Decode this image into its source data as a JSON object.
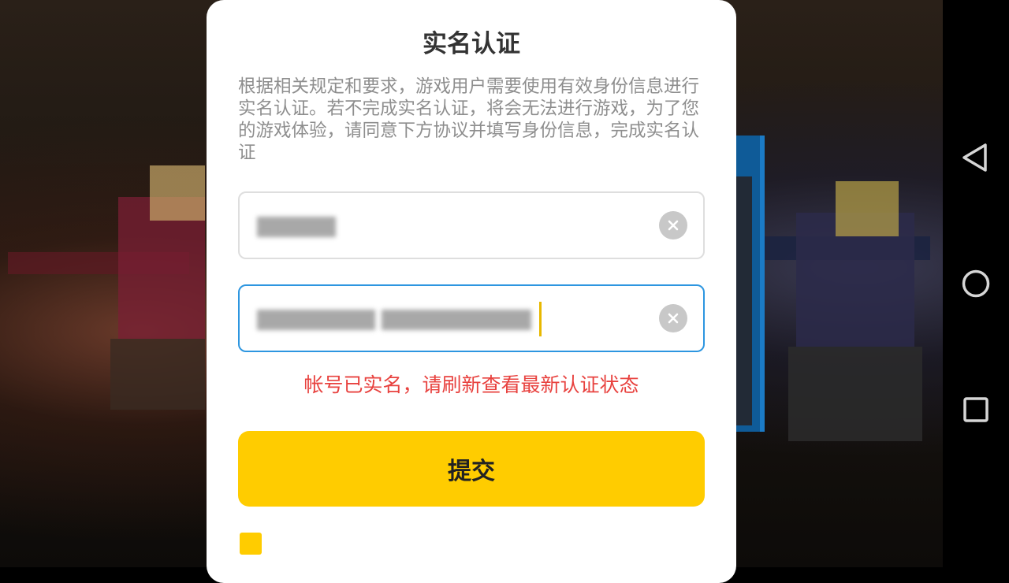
{
  "dialog": {
    "title": "实名认证",
    "description": "根据相关规定和要求，游戏用户需要使用有效身份信息进行实名认证。若不完成实名认证，将会无法进行游戏，为了您的游戏体验，请同意下方协议并填写身份信息，完成实名认证",
    "name_field": {
      "value": "",
      "clear_icon": "clear-icon"
    },
    "id_field": {
      "value": "",
      "clear_icon": "clear-icon"
    },
    "error_message": "帐号已实名，请刷新查看最新认证状态",
    "submit_label": "提交",
    "agreement_checkbox_checked": true
  },
  "nav_bar": {
    "back_icon": "triangle-back-icon",
    "home_icon": "circle-home-icon",
    "recent_icon": "square-recent-icon"
  },
  "colors": {
    "accent": "#ffcc00",
    "error": "#e8423f",
    "focus_border": "#2d96e0"
  }
}
